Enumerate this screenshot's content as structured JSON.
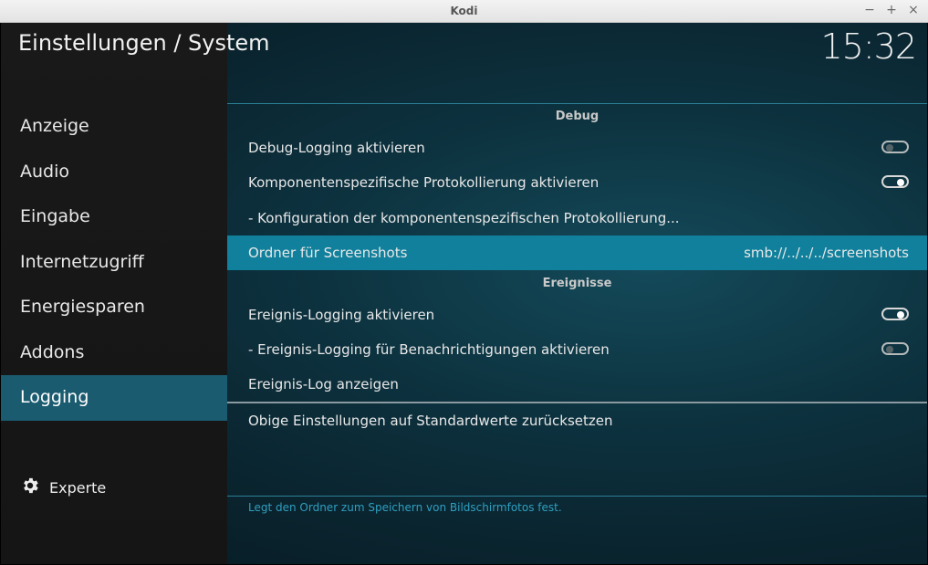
{
  "window": {
    "title": "Kodi",
    "controls": {
      "minimize": "−",
      "maximize": "+",
      "close": "×"
    }
  },
  "header": {
    "title": "Einstellungen / System",
    "clock": "15:32"
  },
  "sidebar": {
    "items": [
      {
        "label": "Anzeige",
        "active": false
      },
      {
        "label": "Audio",
        "active": false
      },
      {
        "label": "Eingabe",
        "active": false
      },
      {
        "label": "Internetzugriff",
        "active": false
      },
      {
        "label": "Energiesparen",
        "active": false
      },
      {
        "label": "Addons",
        "active": false
      },
      {
        "label": "Logging",
        "active": true
      }
    ],
    "expert_label": "Experte",
    "expert_icon": "gear-icon"
  },
  "content": {
    "sections": {
      "debug": "Debug",
      "events": "Ereignisse"
    },
    "rows": {
      "debug_logging": {
        "label": "Debug-Logging aktivieren",
        "toggle": "off"
      },
      "component_logging": {
        "label": "Komponentenspezifische Protokollierung aktivieren",
        "toggle": "on"
      },
      "component_config": {
        "label": "- Konfiguration der komponentenspezifischen Protokollierung..."
      },
      "screenshot_folder": {
        "label": "Ordner für Screenshots",
        "value": "smb://../../../screenshots"
      },
      "event_logging": {
        "label": "Ereignis-Logging aktivieren",
        "toggle": "on"
      },
      "event_notifications": {
        "label": "- Ereignis-Logging für Benachrichtigungen aktivieren",
        "toggle": "off"
      },
      "show_event_log": {
        "label": "Ereignis-Log anzeigen"
      },
      "reset_defaults": {
        "label": "Obige Einstellungen auf Standardwerte zurücksetzen"
      }
    },
    "footer_hint": "Legt den Ordner zum Speichern von Bildschirmfotos fest."
  },
  "colors": {
    "highlight": "#11809c",
    "sidebar_active": "#1a5b70",
    "hint_text": "#2f9fc0"
  }
}
